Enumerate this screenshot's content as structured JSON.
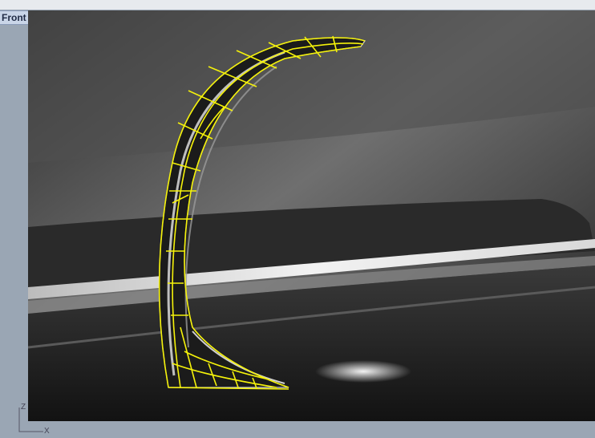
{
  "viewport": {
    "name": "Front",
    "dropdown_icon": "chevron-down-icon"
  },
  "axes": {
    "z_label": "Z",
    "x_label": "X"
  },
  "colors": {
    "selection_highlight": "#f5f20a",
    "tab_background": "#c9d5e8"
  }
}
